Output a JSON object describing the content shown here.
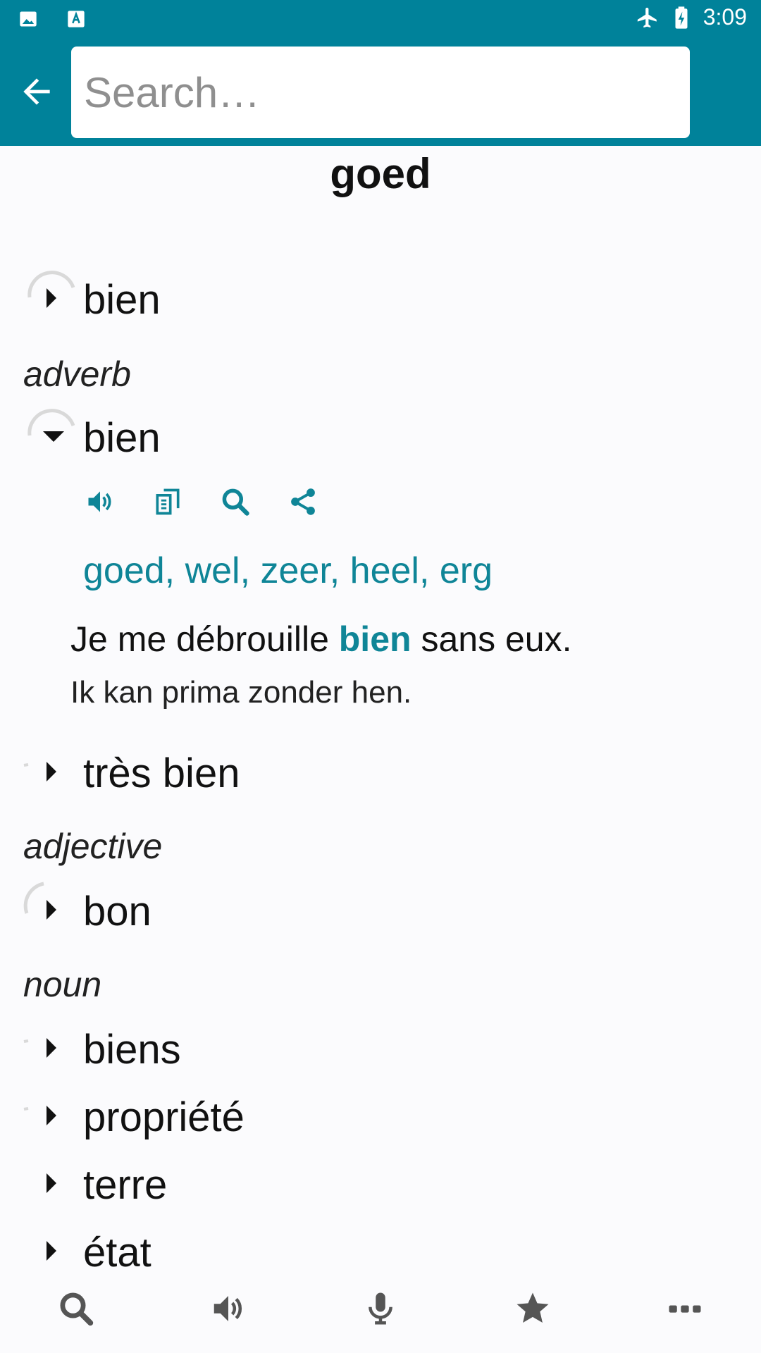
{
  "status_bar": {
    "time": "3:09",
    "icons": [
      "image-icon",
      "app-badge-icon",
      "airplane-mode-icon",
      "battery-charging-icon"
    ]
  },
  "search": {
    "value": "",
    "placeholder": "Search…"
  },
  "headword": "goed",
  "sections": [
    {
      "pos": "",
      "entries": [
        "bien"
      ]
    },
    {
      "pos": "adverb",
      "entries": [
        "bien",
        "très bien"
      ]
    },
    {
      "pos": "adjective",
      "entries": [
        "bon"
      ]
    },
    {
      "pos": "noun",
      "entries": [
        "biens",
        "propriété",
        "terre",
        "état"
      ]
    }
  ],
  "expanded_entry": {
    "word": "bien",
    "action_icons": [
      "speaker-icon",
      "copy-icon",
      "search-icon",
      "share-icon"
    ],
    "translations": "goed, wel, zeer, heel, erg",
    "example": {
      "before": "Je me débrouille ",
      "highlight": "bien",
      "after": " sans eux."
    },
    "example_translation": "Ik kan prima zonder hen."
  },
  "bottom_nav": [
    "search-icon",
    "speaker-icon",
    "microphone-icon",
    "star-icon",
    "more-icon"
  ],
  "colors": {
    "accent": "#00829a",
    "link": "#0f8597",
    "background": "#fbfbfd"
  }
}
